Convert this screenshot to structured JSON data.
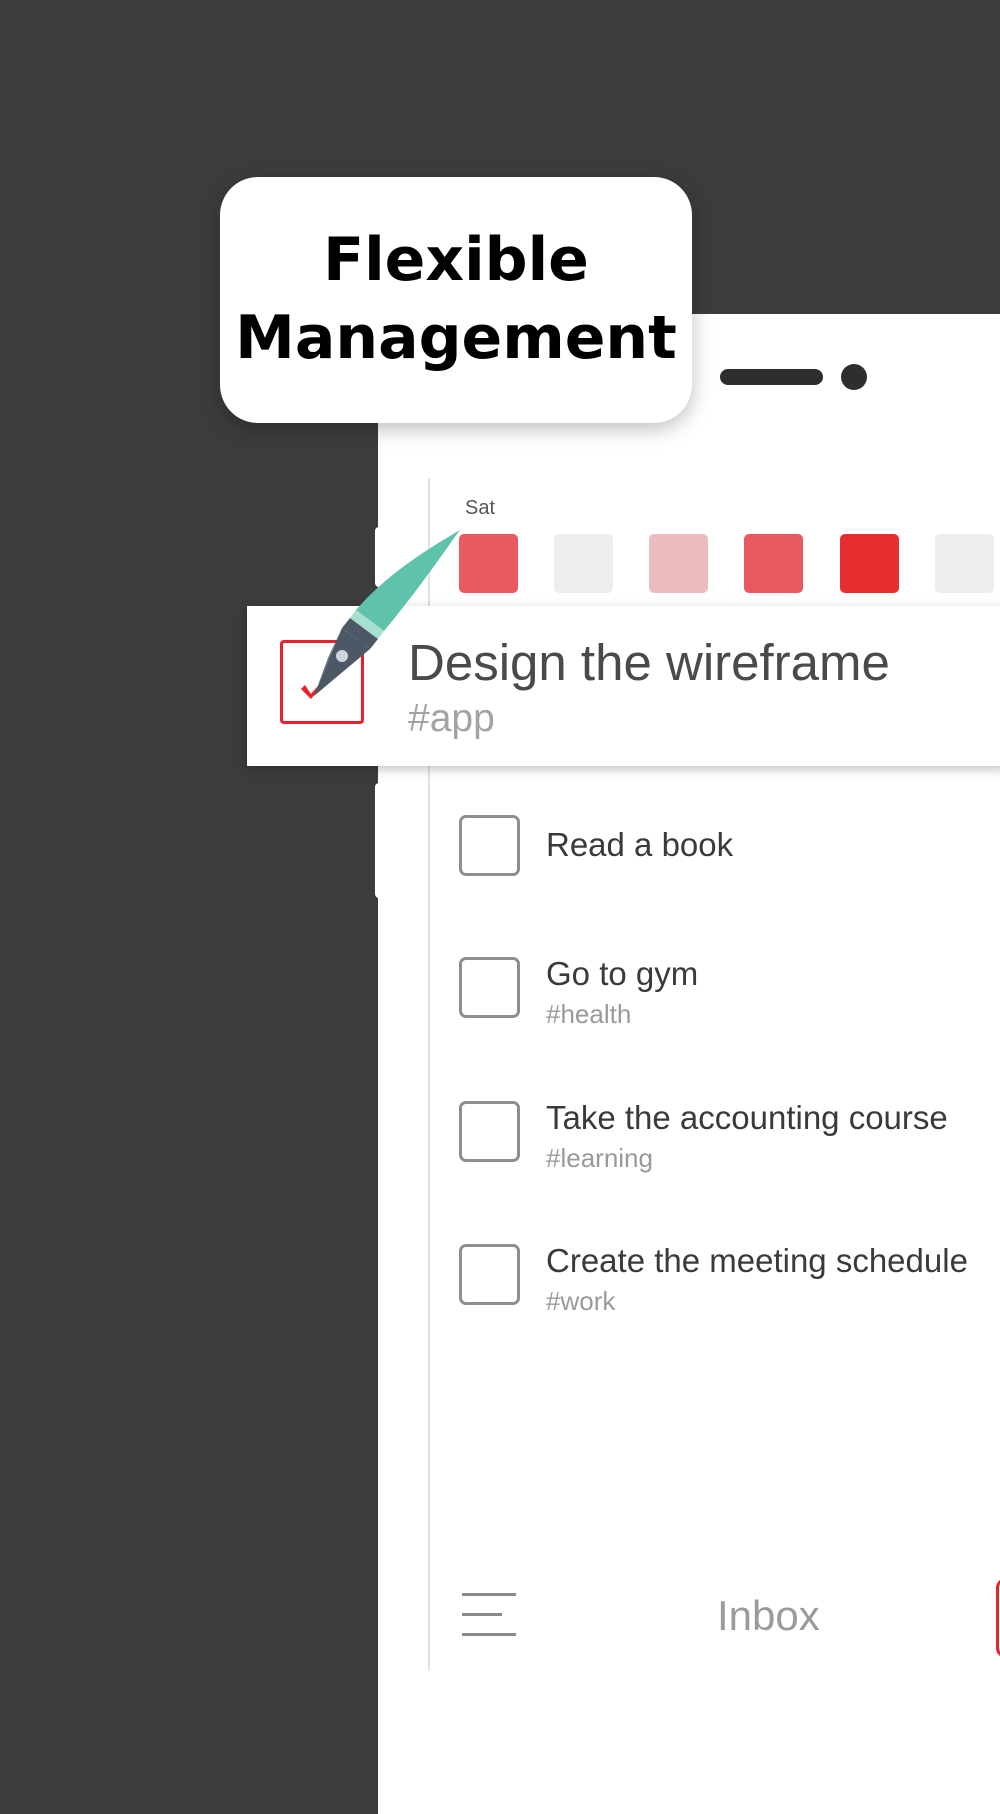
{
  "bubble": {
    "title": "Flexible\nManagement"
  },
  "calendar": {
    "day_label": "Sat",
    "days": [
      {
        "color": "#e85a60"
      },
      {
        "color": "#ededed"
      },
      {
        "color": "#edbcc0"
      },
      {
        "color": "#e85a60"
      },
      {
        "color": "#e62e30"
      },
      {
        "color": "#ededed"
      }
    ]
  },
  "featured_task": {
    "title": "Design the wireframe",
    "tag": "#app",
    "checked": true
  },
  "tasks": [
    {
      "title": "Read a book",
      "tag": ""
    },
    {
      "title": "Go to gym",
      "tag": "#health"
    },
    {
      "title": "Take the accounting course",
      "tag": "#learning"
    },
    {
      "title": "Create the meeting schedule",
      "tag": "#work"
    }
  ],
  "bottom_bar": {
    "title": "Inbox"
  },
  "colors": {
    "background": "#3c3c3c",
    "accent": "#e8202a",
    "pen_body": "#5fc2aa",
    "pen_nib": "#4d5866"
  },
  "icons": [
    "pen-icon",
    "checkmark-icon",
    "menu-icon"
  ]
}
